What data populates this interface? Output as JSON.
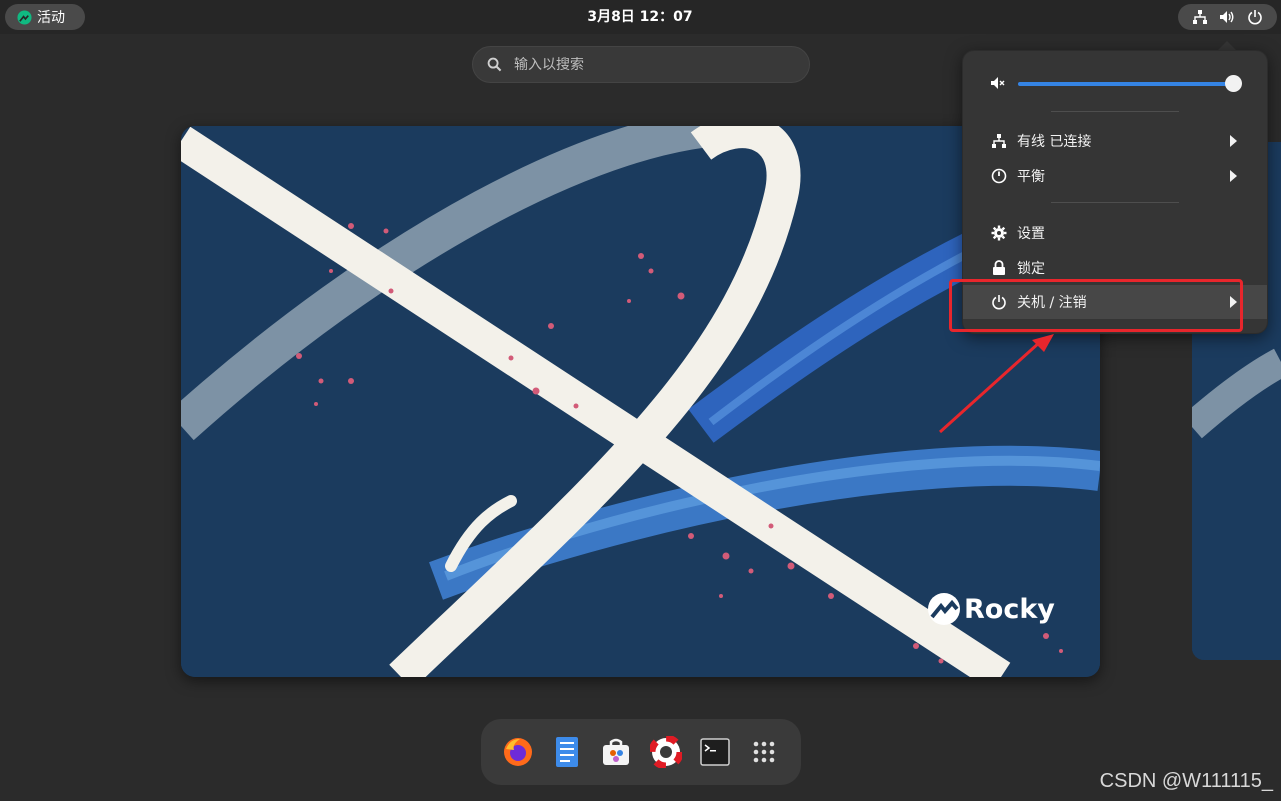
{
  "topbar": {
    "activities_label": "活动",
    "clock": "3月8日 12：07"
  },
  "search": {
    "placeholder": "输入以搜索"
  },
  "quick_settings": {
    "volume_level": 1.0,
    "items": [
      {
        "label": "有线 已连接",
        "icon": "network-wired-icon",
        "submenu": true
      },
      {
        "label": "平衡",
        "icon": "power-profile-icon",
        "submenu": true
      },
      {
        "label": "设置",
        "icon": "gear-icon",
        "submenu": false
      },
      {
        "label": "锁定",
        "icon": "lock-icon",
        "submenu": false
      },
      {
        "label": "关机 / 注销",
        "icon": "power-icon",
        "submenu": true
      }
    ]
  },
  "wallpaper": {
    "brand": "Rocky"
  },
  "dash": {
    "apps": [
      "firefox-icon",
      "text-editor-icon",
      "software-icon",
      "help-icon",
      "terminal-icon",
      "app-grid-icon"
    ]
  },
  "watermark": "CSDN @W111115_",
  "colors": {
    "accent": "#3584e4",
    "annotation": "#e8262c",
    "wallpaper_bg": "#1b3b5e"
  }
}
